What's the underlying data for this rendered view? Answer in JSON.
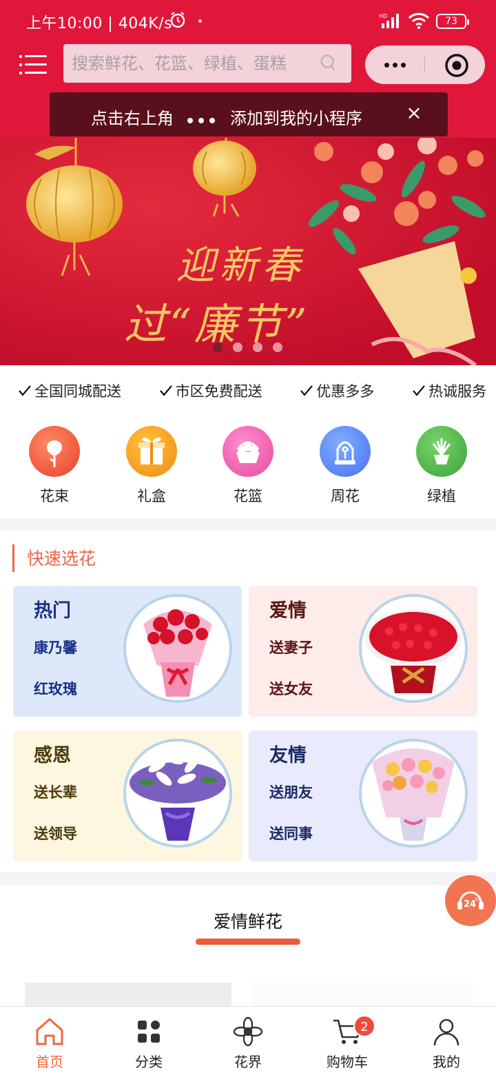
{
  "status_bar": {
    "time": "上午10:00 | 404K/s",
    "battery": "73",
    "icons": [
      "alarm-icon",
      "signal-icon",
      "wifi-icon",
      "battery-icon"
    ]
  },
  "header": {
    "menu_icon": "menu-icon",
    "search_placeholder": "搜索鲜花、花篮、绿植、蛋糕",
    "accent_color": "#e0173a"
  },
  "tip": {
    "text_before": "点击右上角",
    "text_after": "添加到我的小程序",
    "close": "×"
  },
  "banner": {
    "line1": "迎新春",
    "line2": "过“廉节”",
    "slide_count": 4,
    "active_slide": 1
  },
  "features": [
    "全国同城配送",
    "市区免费配送",
    "优惠多多",
    "热诚服务"
  ],
  "categories": [
    {
      "label": "花束",
      "icon": "rose-icon",
      "color": "#f05a3d"
    },
    {
      "label": "礼盒",
      "icon": "gift-icon",
      "color": "#f59a1b"
    },
    {
      "label": "花篮",
      "icon": "basket-icon",
      "color": "#ee5aa6"
    },
    {
      "label": "周花",
      "icon": "glass-dome-icon",
      "color": "#4f7ff0"
    },
    {
      "label": "绿植",
      "icon": "potted-plant-icon",
      "color": "#49b54a"
    }
  ],
  "quick_pick": {
    "title": "快速选花",
    "cards": [
      {
        "title": "热门",
        "links": [
          "康乃馨",
          "红玫瑰"
        ],
        "bg": "#dde9fb",
        "color": "#1a2f86"
      },
      {
        "title": "爱情",
        "links": [
          "送妻子",
          "送女友"
        ],
        "bg": "#fdecea",
        "color": "#5a1414"
      },
      {
        "title": "感恩",
        "links": [
          "送长辈",
          "送领导"
        ],
        "bg": "#fdf6e0",
        "color": "#4a3a0c"
      },
      {
        "title": "友情",
        "links": [
          "送朋友",
          "送同事"
        ],
        "bg": "#e9eafb",
        "color": "#1a2a66"
      }
    ]
  },
  "section": {
    "title": "爱情鲜花"
  },
  "tabbar": {
    "items": [
      {
        "label": "首页",
        "icon": "home-icon"
      },
      {
        "label": "分类",
        "icon": "category-grid-icon"
      },
      {
        "label": "花界",
        "icon": "flower-icon"
      },
      {
        "label": "购物车",
        "icon": "cart-icon"
      },
      {
        "label": "我的",
        "icon": "profile-icon"
      }
    ],
    "active_index": 0,
    "cart_badge": "2",
    "active_color": "#ec6a3d"
  }
}
